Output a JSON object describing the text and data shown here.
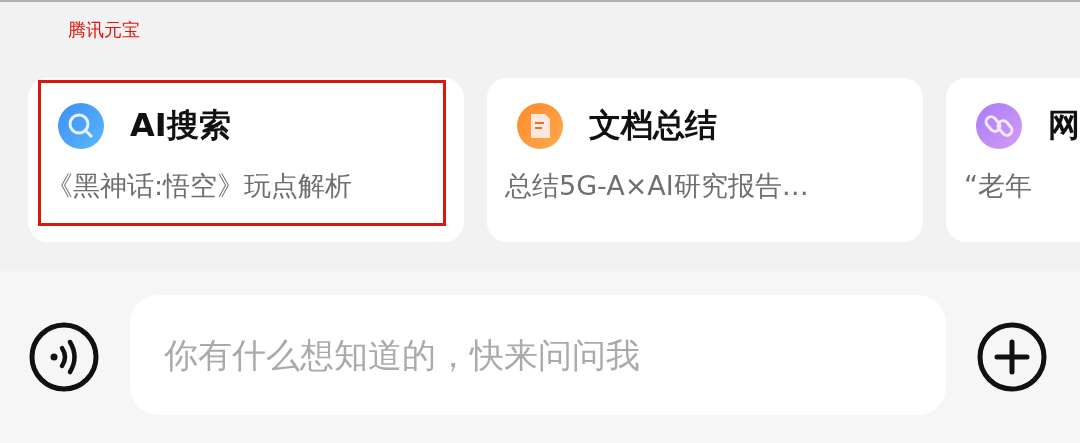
{
  "caption": "腾讯元宝",
  "cards": [
    {
      "kind": "search",
      "title": "AI搜索",
      "subtitle": "《黑神话:悟空》玩点解析",
      "highlighted": true
    },
    {
      "kind": "document",
      "title": "文档总结",
      "subtitle": "总结5G-A×AI研究报告…",
      "highlighted": false
    },
    {
      "kind": "link",
      "title": "网",
      "subtitle": "“老年",
      "highlighted": false
    }
  ],
  "input": {
    "placeholder": "你有什么想知道的，快来问问我"
  }
}
